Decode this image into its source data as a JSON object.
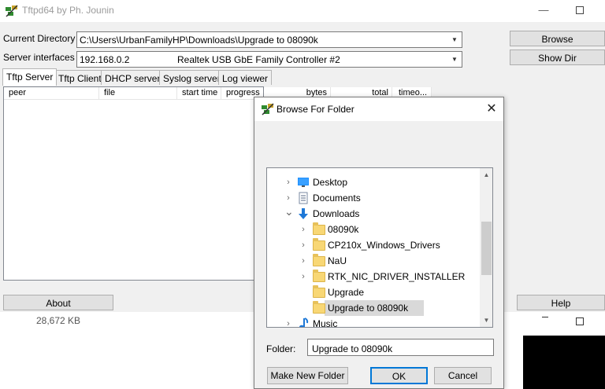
{
  "window": {
    "title": "Tftpd64 by Ph. Jounin",
    "minimize_glyph": "—"
  },
  "config": {
    "current_directory_label": "Current Directory",
    "current_directory_value": "C:\\Users\\UrbanFamilyHP\\Downloads\\Upgrade to 08090k",
    "server_interfaces_label": "Server interfaces",
    "server_ip": "192.168.0.2",
    "server_adapter": "Realtek USB GbE Family Controller #2",
    "browse_label": "Browse",
    "showdir_label": "Show Dir"
  },
  "tabs": [
    "Tftp Server",
    "Tftp Client",
    "DHCP server",
    "Syslog server",
    "Log viewer"
  ],
  "columns": [
    "peer",
    "file",
    "start time",
    "progress",
    "bytes",
    "total",
    "timeo..."
  ],
  "footer": {
    "about_label": "About",
    "help_label": "Help"
  },
  "background_text": {
    "size": "28,672 KB"
  },
  "dialog": {
    "title": "Browse For Folder",
    "close_glyph": "✕",
    "tree": [
      {
        "label": "Desktop",
        "icon": "desktop-icon",
        "level": 0,
        "expander": "collapsed"
      },
      {
        "label": "Documents",
        "icon": "documents-icon",
        "level": 0,
        "expander": "collapsed"
      },
      {
        "label": "Downloads",
        "icon": "downloads-icon",
        "level": 0,
        "expander": "expanded"
      },
      {
        "label": "08090k",
        "icon": "folder-icon",
        "level": 1,
        "expander": "collapsed"
      },
      {
        "label": "CP210x_Windows_Drivers",
        "icon": "folder-icon",
        "level": 1,
        "expander": "collapsed"
      },
      {
        "label": "NaU",
        "icon": "folder-icon",
        "level": 1,
        "expander": "collapsed"
      },
      {
        "label": "RTK_NIC_DRIVER_INSTALLER",
        "icon": "folder-icon",
        "level": 1,
        "expander": "collapsed"
      },
      {
        "label": "Upgrade",
        "icon": "folder-icon",
        "level": 1,
        "expander": "none"
      },
      {
        "label": "Upgrade to 08090k",
        "icon": "folder-icon",
        "level": 1,
        "expander": "none",
        "selected": true
      },
      {
        "label": "Music",
        "icon": "music-icon",
        "level": 0,
        "expander": "collapsed"
      }
    ],
    "folder_label": "Folder:",
    "folder_value": "Upgrade to 08090k",
    "make_new_folder_label": "Make New Folder",
    "ok_label": "OK",
    "cancel_label": "Cancel"
  },
  "colors": {
    "accent": "#0078d7",
    "selection": "#d9d9d9",
    "folder": "#f8d775"
  }
}
